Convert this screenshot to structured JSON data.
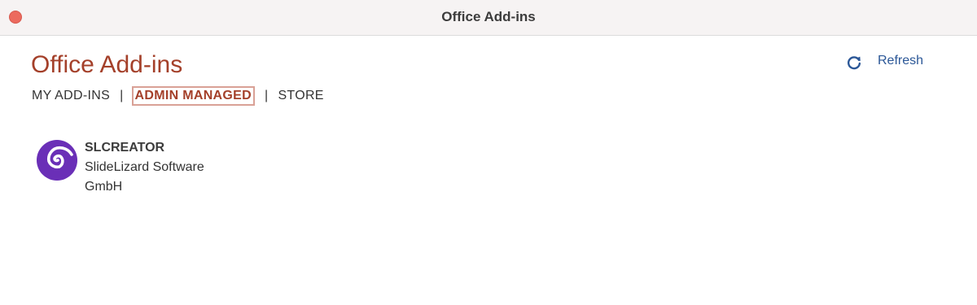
{
  "window": {
    "title": "Office Add-ins"
  },
  "header": {
    "title": "Office Add-ins",
    "refresh_label": "Refresh"
  },
  "tabs": [
    {
      "label": "MY ADD-INS",
      "active": false
    },
    {
      "label": "ADMIN MANAGED",
      "active": true
    },
    {
      "label": "STORE",
      "active": false
    }
  ],
  "separator": "|",
  "addins": [
    {
      "name": "SLCREATOR",
      "publisher": "SlideLizard Software GmbH",
      "icon": "spiral-icon"
    }
  ],
  "colors": {
    "accent": "#a4402a",
    "link": "#2b5797",
    "close_button": "#ec6a5e",
    "logo_purple": "#6a2fb7"
  }
}
